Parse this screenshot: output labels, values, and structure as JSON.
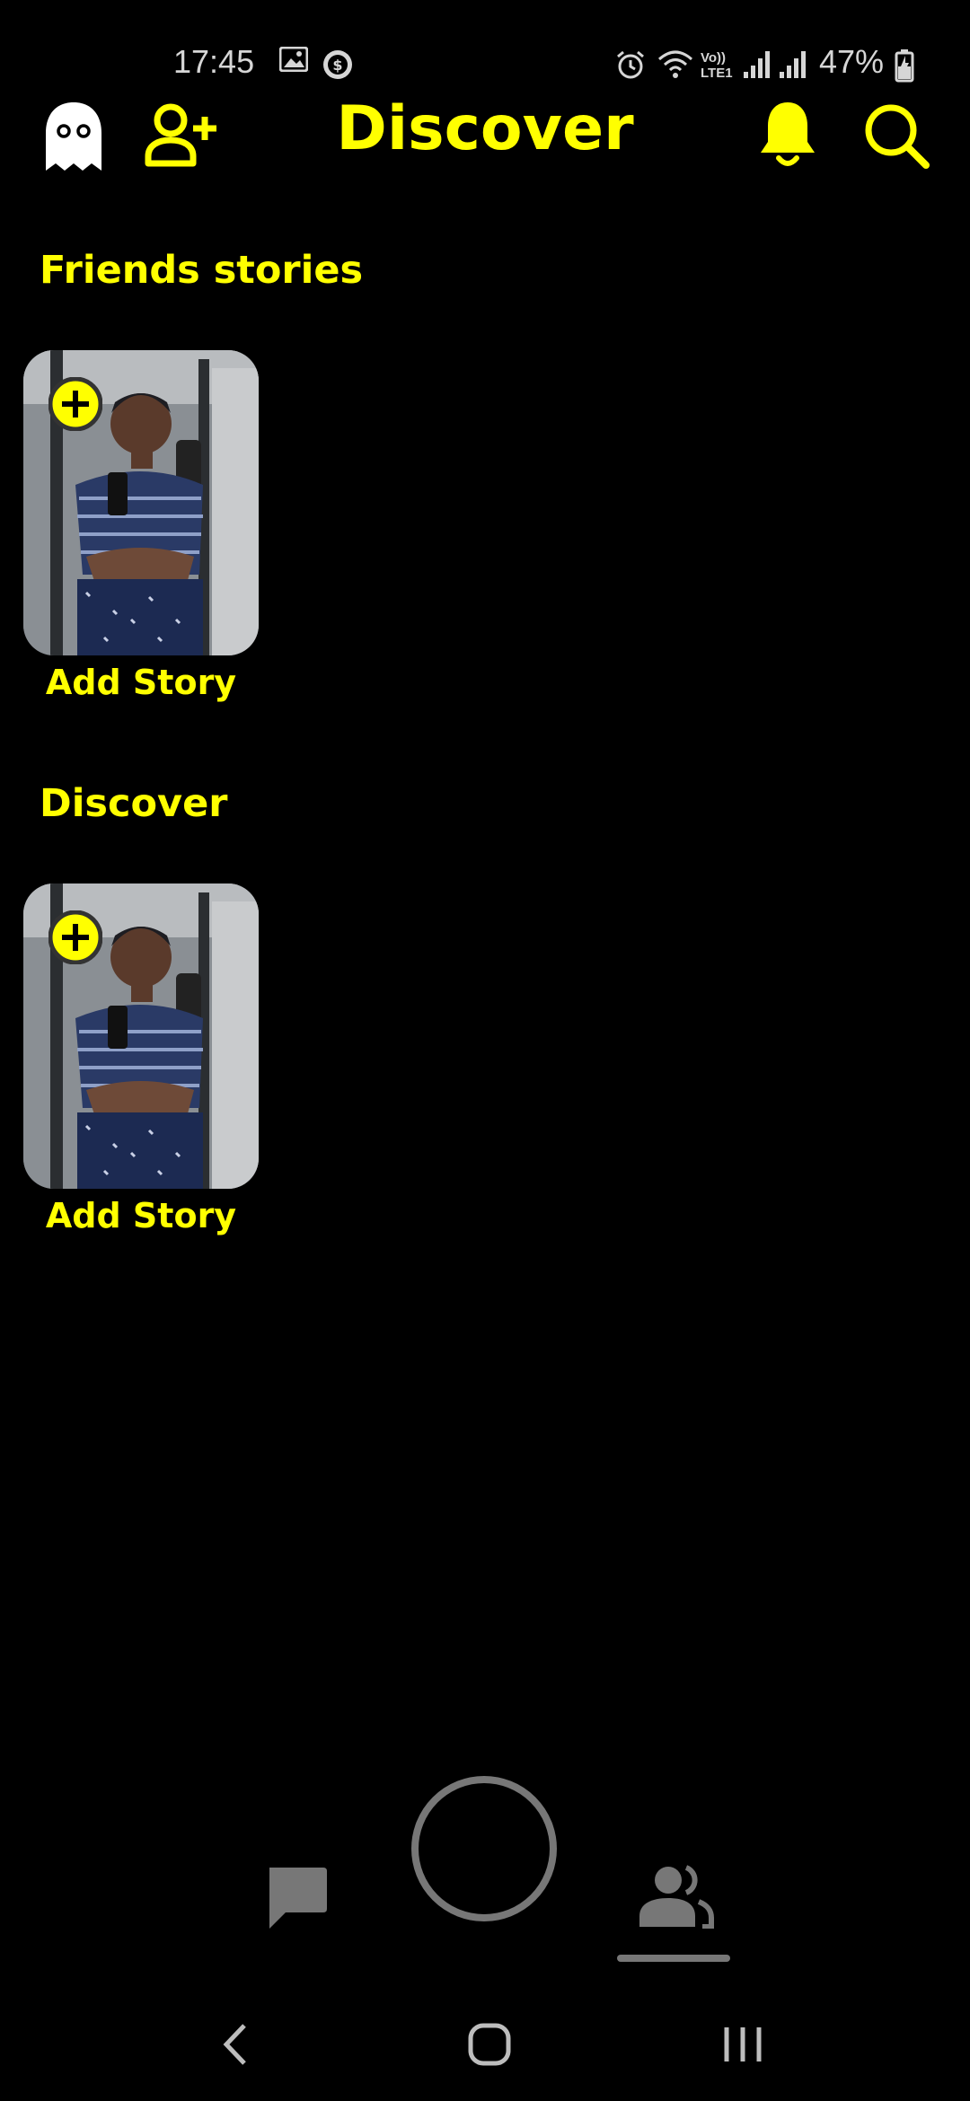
{
  "status_bar": {
    "time": "17:45",
    "battery": "47%",
    "icons": [
      "image-icon",
      "currency-icon",
      "alarm-icon",
      "wifi-icon",
      "volte-lte-icon",
      "signal-icon",
      "signal-icon",
      "battery-icon"
    ],
    "volte_line1": "Vo))",
    "volte_line2": "LTE1"
  },
  "header": {
    "title": "Discover",
    "left_icons": [
      "ghost-icon",
      "add-friend-icon"
    ],
    "right_icons": [
      "bell-icon",
      "search-icon"
    ]
  },
  "sections": [
    {
      "title": "Friends stories",
      "card_label": "Add Story"
    },
    {
      "title": "Discover",
      "card_label": "Add Story"
    }
  ],
  "bottom_nav": {
    "items": [
      "chat-icon",
      "camera-capture-button",
      "friends-icon"
    ],
    "active": "friends-icon"
  },
  "system_nav": [
    "back-icon",
    "home-icon",
    "recents-icon"
  ],
  "colors": {
    "accent": "#ffff00",
    "background": "#000000",
    "inactive": "#777777"
  }
}
